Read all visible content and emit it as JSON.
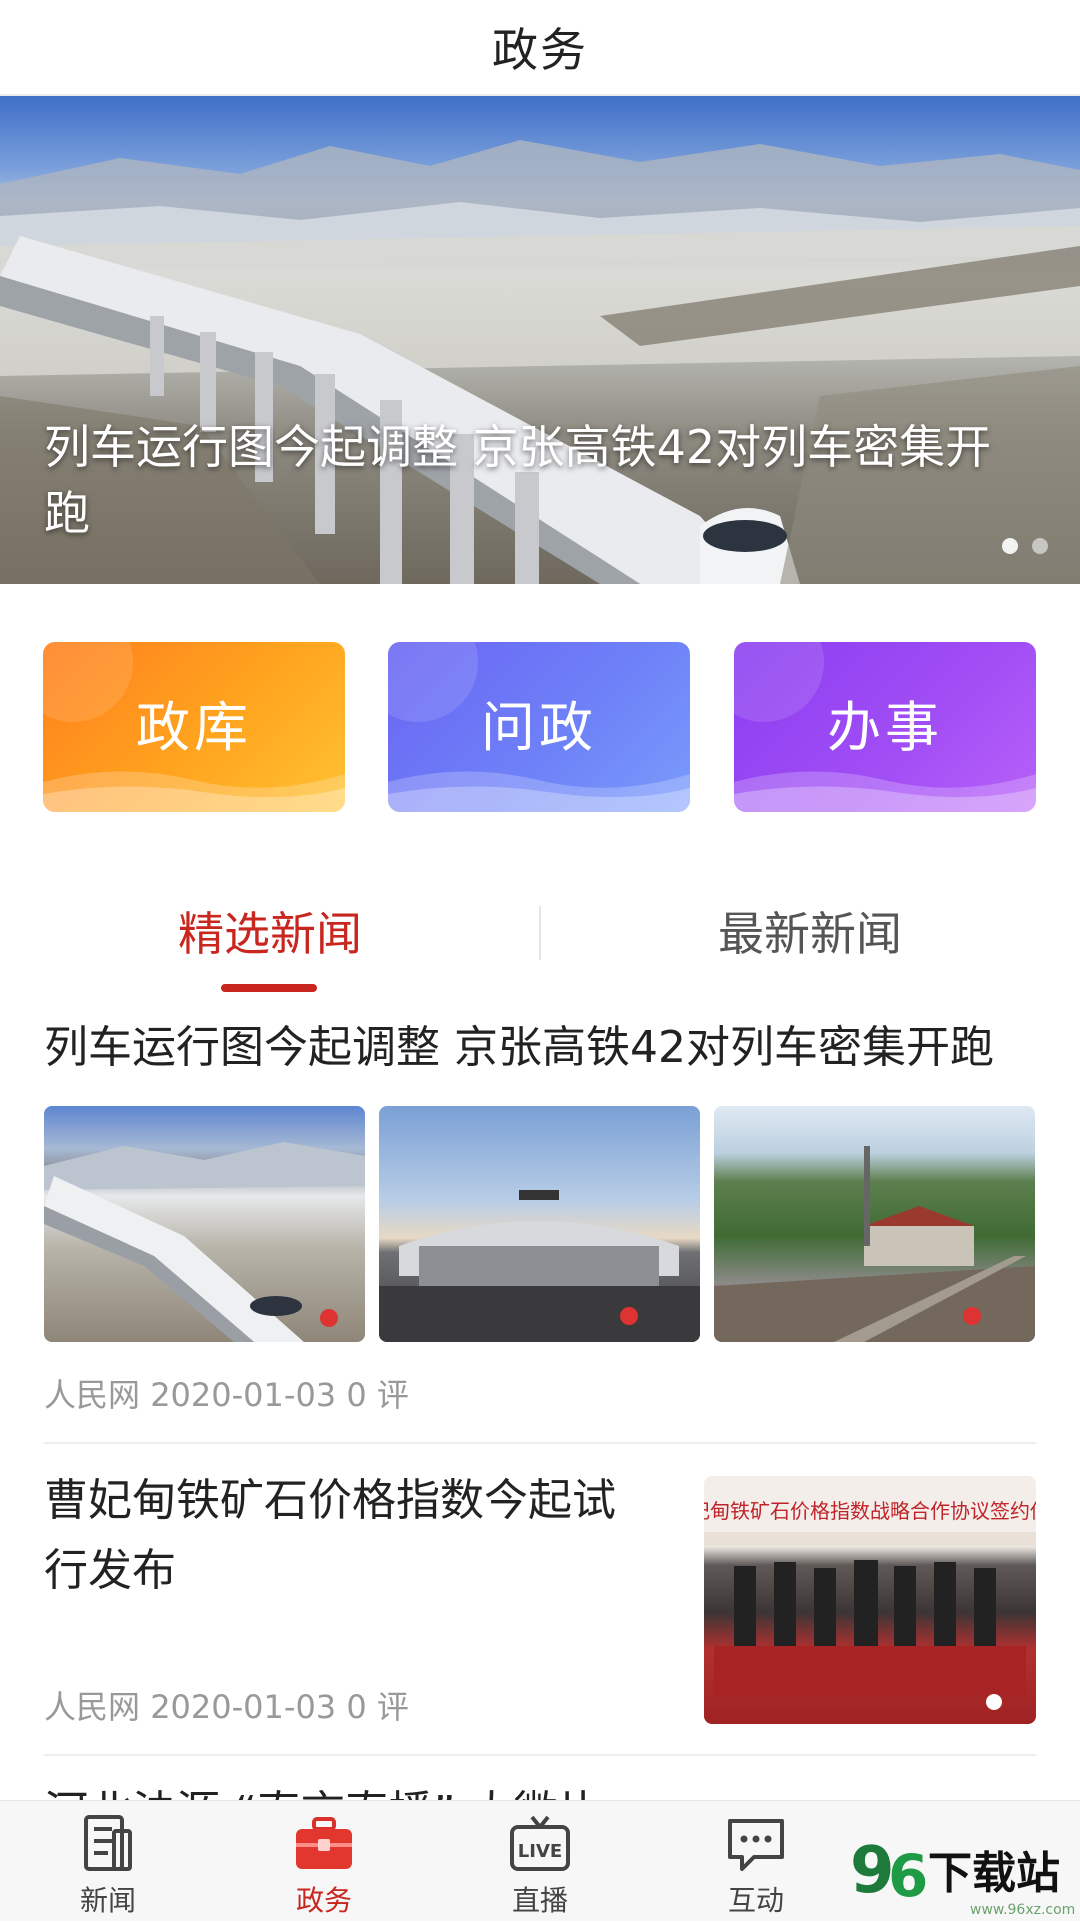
{
  "header": {
    "title": "政务"
  },
  "banner": {
    "caption": "列车运行图今起调整 京张高铁42对列车密集开跑",
    "dots": 2,
    "active_dot": 1
  },
  "tiles": [
    {
      "label": "政库",
      "color": "#ff8c1f"
    },
    {
      "label": "问政",
      "color": "#6d7cf6"
    },
    {
      "label": "办事",
      "color": "#9b48f3"
    }
  ],
  "tabs": {
    "selected": "精选新闻",
    "other": "最新新闻"
  },
  "articles": [
    {
      "title": "列车运行图今起调整 京张高铁42对列车密集开跑",
      "source": "人民网",
      "date": "2020-01-03",
      "comments": "0 评"
    },
    {
      "title": "曹妃甸铁矿石价格指数今起试行发布",
      "source": "人民网",
      "date": "2020-01-03",
      "comments": "0 评",
      "image_text": "曹妃甸铁矿石价格指数战略合作协议签约仪式"
    },
    {
      "title": "河北法源 “直言直播” 大微片"
    }
  ],
  "navbar": {
    "items": [
      "新闻",
      "政务",
      "直播",
      "互动"
    ],
    "active": "政务"
  },
  "watermark": {
    "text": "96下载站",
    "sub": "www.96xz.com"
  },
  "colors": {
    "accent": "#c8261e",
    "muted": "#999999"
  }
}
